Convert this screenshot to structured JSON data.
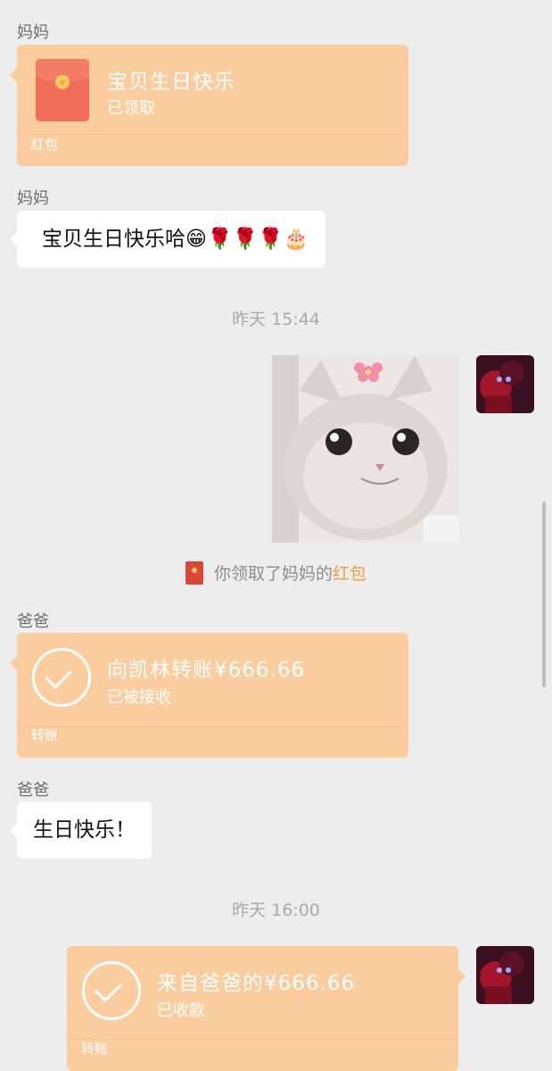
{
  "messages": {
    "m1": {
      "sender": "妈妈",
      "title": "宝贝生日快乐",
      "status": "已领取",
      "kind": "红包"
    },
    "m2": {
      "sender": "妈妈",
      "text": "宝贝生日快乐哈😁🌹🌹🌹🎂"
    },
    "time1": "昨天 15:44",
    "system_notice": {
      "text": "你领取了妈妈的",
      "link": "红包"
    },
    "m3": {
      "sender": "爸爸",
      "title": "向凯林转账¥666.66",
      "status": "已被接收",
      "kind": "转账"
    },
    "m4": {
      "sender": "爸爸",
      "text": "生日快乐！"
    },
    "time2": "昨天 16:00",
    "m5": {
      "title": "来自爸爸的¥666.66",
      "status": "已收款",
      "kind": "转账"
    }
  },
  "colors": {
    "background": "#ededed",
    "card": "#fbcd9e",
    "highlight": "#e7a04a",
    "red_packet": "#f06e58"
  },
  "icons": {
    "red_packet": "red-envelope-icon",
    "check": "check-circle-icon"
  }
}
